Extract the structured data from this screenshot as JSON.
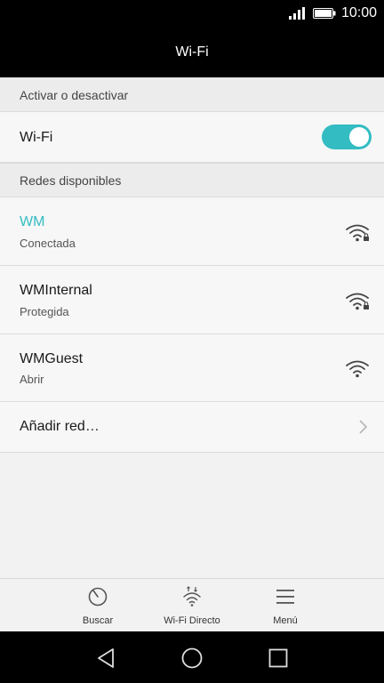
{
  "status_bar": {
    "time": "10:00"
  },
  "app_bar": {
    "title": "Wi-Fi"
  },
  "sections": {
    "toggle_header": "Activar o desactivar",
    "networks_header": "Redes disponibles"
  },
  "wifi_toggle": {
    "label": "Wi-Fi",
    "state": "on"
  },
  "networks": [
    {
      "name": "WM",
      "status": "Conectada",
      "secured": true
    },
    {
      "name": "WMInternal",
      "status": "Protegida",
      "secured": true
    },
    {
      "name": "WMGuest",
      "status": "Abrir",
      "secured": false
    }
  ],
  "add_network": {
    "label": "Añadir red…"
  },
  "bottom_tabs": [
    {
      "label": "Buscar",
      "icon": "scan-icon"
    },
    {
      "label": "Wi-Fi Directo",
      "icon": "wifi-direct-icon"
    },
    {
      "label": "Menú",
      "icon": "menu-icon"
    }
  ],
  "colors": {
    "accent": "#33bcc2",
    "bar_bg": "#000000",
    "page_bg": "#f2f2f2"
  }
}
